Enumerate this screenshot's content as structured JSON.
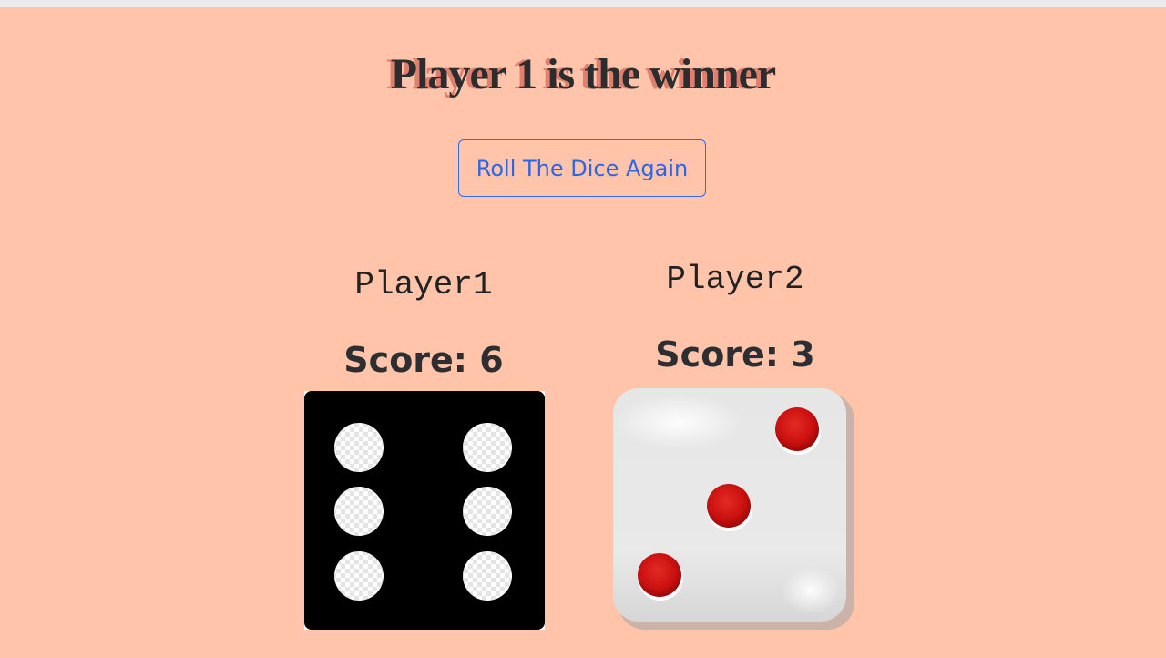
{
  "header": {
    "winner_text": "Player 1 is the winner"
  },
  "controls": {
    "roll_again_label": "Roll The Dice Again"
  },
  "players": [
    {
      "name": "Player1",
      "score_text": "Score: 6",
      "die_value": 6,
      "die_style": "black"
    },
    {
      "name": "Player2",
      "score_text": "Score: 3",
      "die_value": 3,
      "die_style": "white"
    }
  ],
  "colors": {
    "background": "#ffc4aa",
    "button_accent": "#2a66e8",
    "title_shadow": "#e07f6e",
    "pip_red": "#d01818"
  }
}
